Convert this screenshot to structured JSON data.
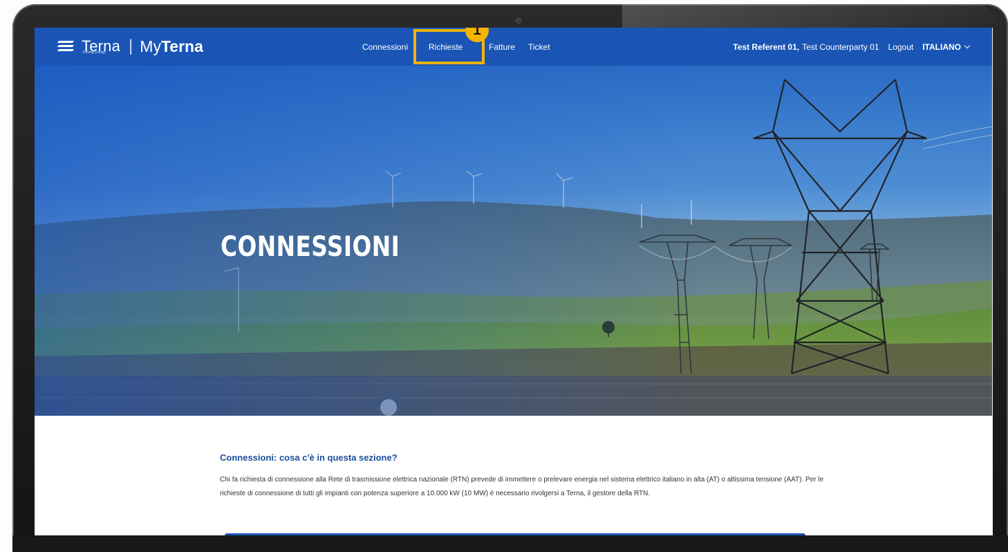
{
  "brand": {
    "logo_word": "Terna",
    "logo_tagline": "Driving Energy",
    "separator": "|",
    "portal_prefix": "My",
    "portal_name": "Terna"
  },
  "nav": {
    "items": [
      {
        "label": "Connessioni"
      },
      {
        "label": "Richieste"
      },
      {
        "label": "Fatture"
      },
      {
        "label": "Ticket"
      }
    ]
  },
  "user": {
    "referent": "Test Referent 01,",
    "counterparty": "Test Counterparty 01",
    "logout": "Logout",
    "language": "ITALIANO"
  },
  "callout": {
    "number": "1",
    "color": "#f4b400"
  },
  "hero": {
    "title": "CONNESSIONI"
  },
  "section": {
    "title": "Connessioni: cosa c'è in questa sezione?",
    "body": "Chi fa richiesta di connessione alla Rete di trasmissione elettrica nazionale (RTN) prevede di immettere o prelevare energia nel sistema elettrico italiano in alta (AT) o altissima tensione (AAT). Per le richieste di connessione di tutti gli impianti con potenza superiore a 10.000 kW (10 MW) è necessario rivolgersi a Terna, il gestore della RTN."
  },
  "colors": {
    "brand_blue": "#1a55b5",
    "heading_blue": "#1a4f9e",
    "callout_yellow": "#f4b400"
  }
}
